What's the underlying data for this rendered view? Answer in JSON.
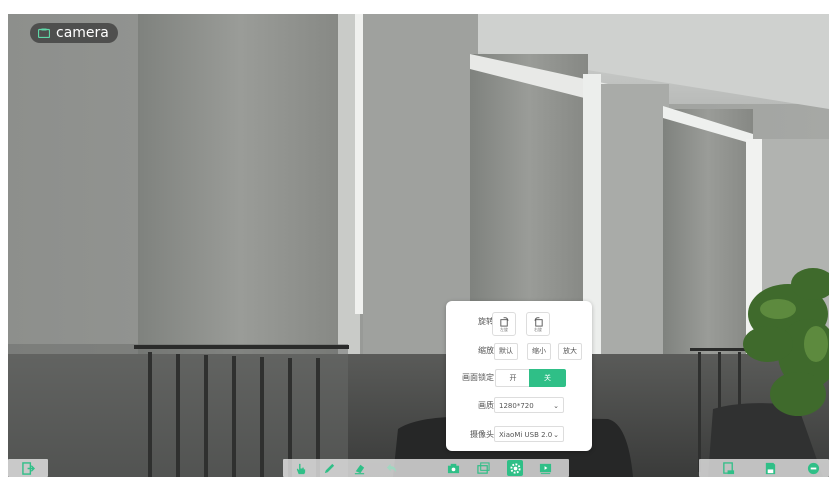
{
  "camera_badge": {
    "label": "camera",
    "icon": "camera-icon"
  },
  "settings_panel": {
    "rotate": {
      "label": "旋转",
      "left_label": "左旋",
      "right_label": "右旋"
    },
    "zoom": {
      "label": "缩放",
      "options": [
        "默认",
        "缩小",
        "放大"
      ]
    },
    "lock": {
      "label": "画面锁定",
      "on_label": "开",
      "off_label": "关",
      "selected": "关"
    },
    "quality": {
      "label": "画质",
      "value": "1280*720"
    },
    "camera": {
      "label": "摄像头",
      "value": "XiaoMi USB 2.0"
    }
  },
  "colors": {
    "accent": "#2fbf87",
    "badge_bg": "#3c3c3c"
  },
  "toolbar": {
    "left": [
      "exit-icon"
    ],
    "center": [
      "hand-icon",
      "pen-icon",
      "eraser-icon",
      "undo-icon",
      "camera-icon",
      "image-icon",
      "settings-icon",
      "video-icon"
    ],
    "active": "settings-icon",
    "right": [
      "page-icon",
      "save-icon",
      "menu-icon"
    ]
  }
}
